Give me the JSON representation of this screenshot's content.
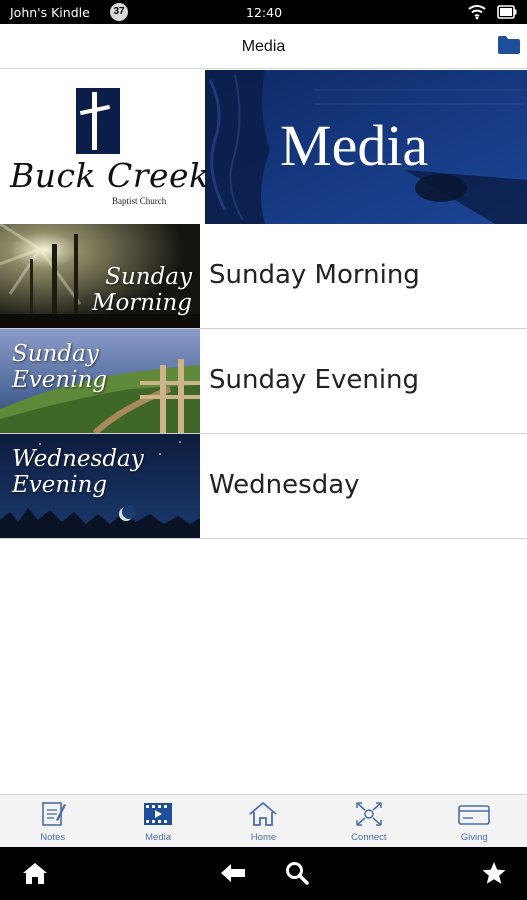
{
  "status_bar": {
    "device_name": "John's Kindle",
    "notification_count": "37",
    "time": "12:40"
  },
  "header": {
    "title": "Media"
  },
  "banner": {
    "church_name": "Buck Creek",
    "church_subtitle": "Baptist Church",
    "title": "Media"
  },
  "media_items": [
    {
      "thumb_text_line1": "Sunday",
      "thumb_text_line2": "Morning",
      "label": "Sunday Morning"
    },
    {
      "thumb_text_line1": "Sunday",
      "thumb_text_line2": "Evening",
      "label": "Sunday Evening"
    },
    {
      "thumb_text_line1": "Wednesday",
      "thumb_text_line2": "Evening",
      "label": "Wednesday"
    }
  ],
  "tabs": [
    {
      "label": "Notes",
      "icon": "notes-icon"
    },
    {
      "label": "Media",
      "icon": "media-icon"
    },
    {
      "label": "Home",
      "icon": "home-icon"
    },
    {
      "label": "Connect",
      "icon": "connect-icon"
    },
    {
      "label": "Giving",
      "icon": "giving-icon"
    }
  ],
  "nav_bar": {
    "icons": [
      "home-icon",
      "back-arrow-icon",
      "search-icon",
      "star-icon"
    ]
  },
  "colors": {
    "brand_blue": "#173a82",
    "tab_accent": "#4a6ea8",
    "folder_blue": "#1e4d9a"
  }
}
